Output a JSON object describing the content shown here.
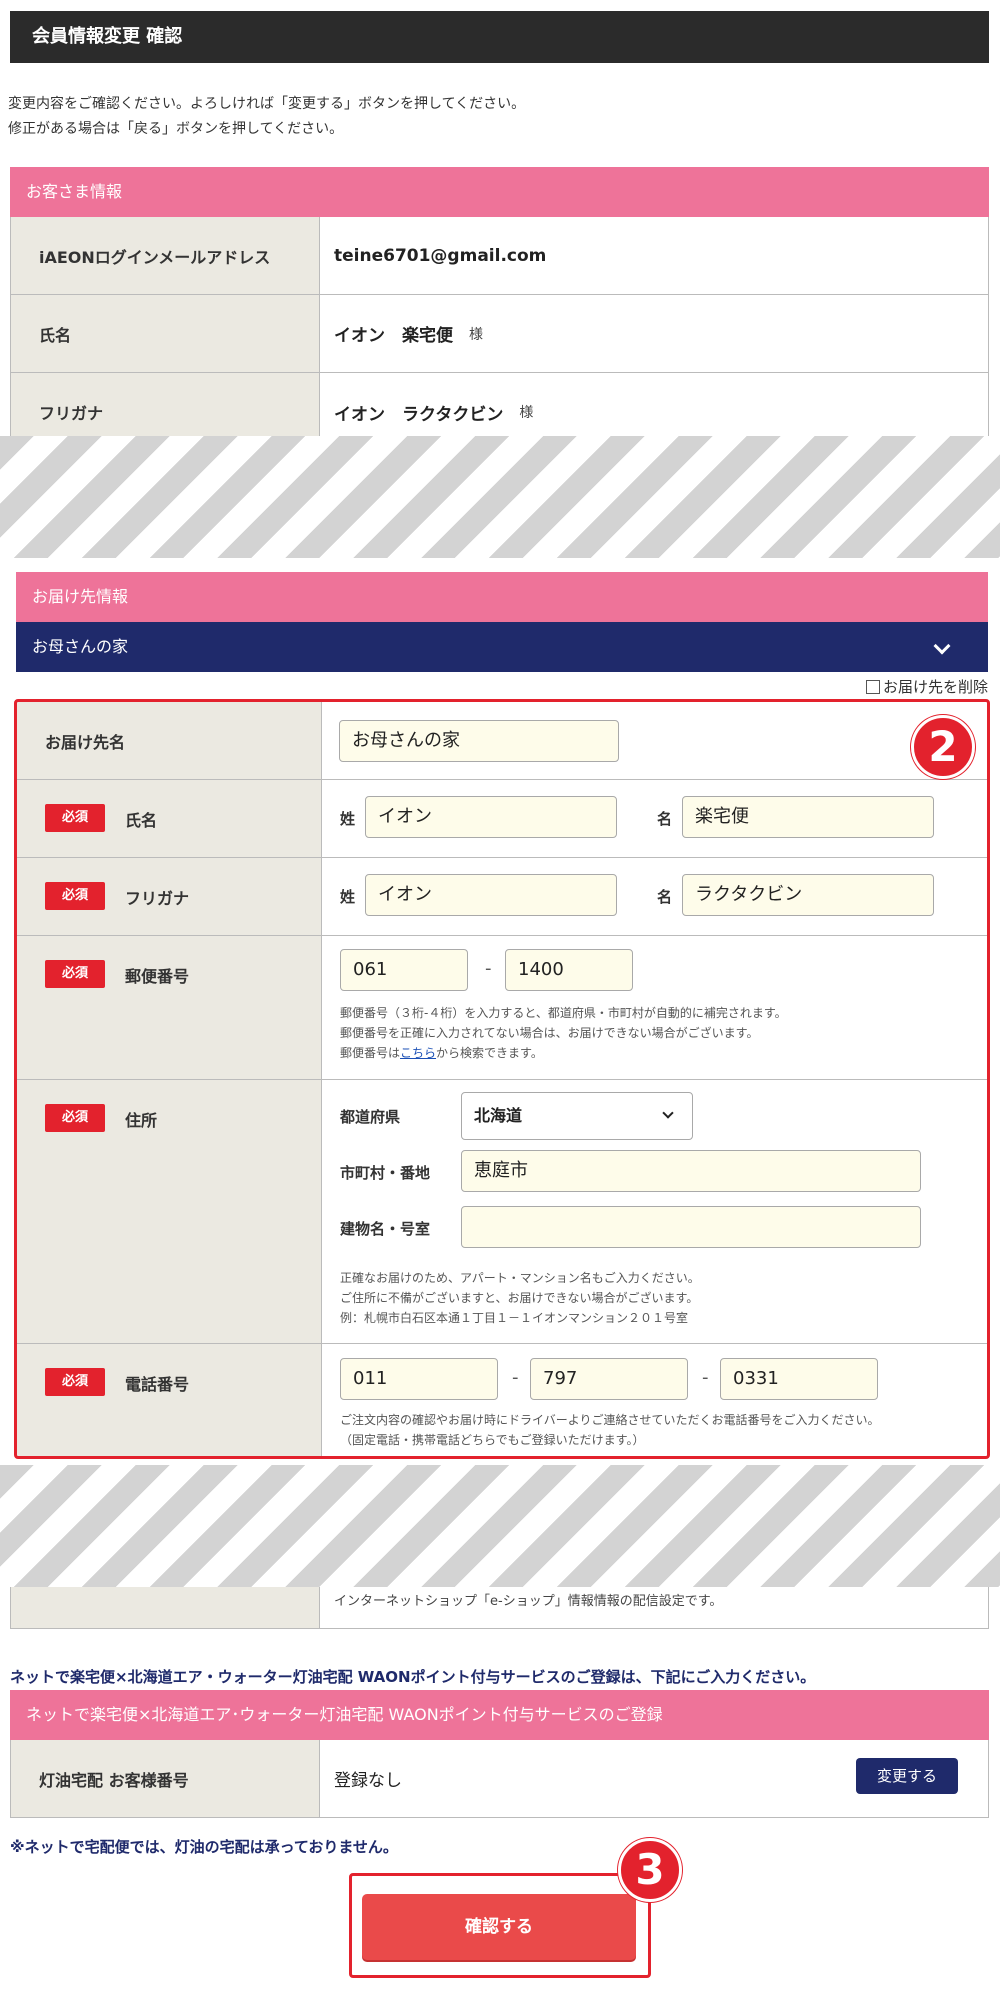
{
  "page_title": "会員情報変更 確認",
  "intro": {
    "line1": "変更内容をご確認ください。よろしければ「変更する」ボタンを押してください。",
    "line2": "修正がある場合は「戻る」ボタンを押してください。"
  },
  "customer": {
    "header": "お客さま情報",
    "rows": [
      {
        "label": "iAEONログインメールアドレス",
        "value": "teine6701@gmail.com",
        "suffix": ""
      },
      {
        "label": "氏名",
        "value": "イオン　楽宅便",
        "suffix": "様"
      },
      {
        "label": "フリガナ",
        "value": "イオン　ラクタクビン",
        "suffix": "様"
      }
    ]
  },
  "delivery": {
    "header": "お届け先情報",
    "selected_address": "お母さんの家",
    "delete_label": "お届け先を削除",
    "required_label": "必須",
    "name_label": "お届け先名",
    "name_value": "お母さんの家",
    "fullname": {
      "label": "氏名",
      "sei_label": "姓",
      "sei_value": "イオン",
      "mei_label": "名",
      "mei_value": "楽宅便"
    },
    "kana": {
      "label": "フリガナ",
      "sei_label": "姓",
      "sei_value": "イオン",
      "mei_label": "名",
      "mei_value": "ラクタクビン"
    },
    "postal": {
      "label": "郵便番号",
      "part1": "061",
      "separator": "-",
      "part2": "1400",
      "note1": "郵便番号（３桁-４桁）を入力すると、都道府県・市町村が自動的に補完されます。",
      "note2": "郵便番号を正確に入力されてない場合は、お届けできない場合がございます。",
      "note3_pre": "郵便番号は",
      "note3_link": "こちら",
      "note3_post": "から検索できます。"
    },
    "address": {
      "label": "住所",
      "pref_label": "都道府県",
      "pref_value": "北海道",
      "city_label": "市町村・番地",
      "city_value": "恵庭市",
      "building_label": "建物名・号室",
      "building_value": "",
      "note1": "正確なお届けのため、アパート・マンション名もご入力ください。",
      "note2": "ご住所に不備がございますと、お届けできない場合がございます。",
      "note3": "例：札幌市白石区本通１丁目１－１イオンマンション２０１号室"
    },
    "phone": {
      "label": "電話番号",
      "part1": "011",
      "part2": "797",
      "part3": "0331",
      "separator": "-",
      "note1": "ご注文内容の確認やお届け時にドライバーよりご連絡させていただくお電話番号をご入力ください。",
      "note2": "（固定電話・携帯電話どちらでもご登録いただけます。）"
    }
  },
  "newsletter_note": "インターネットショップ「e-ショップ」情報情報の配信設定です。",
  "kerosene": {
    "caption": "ネットで楽宅便×北海道エア・ウォーター灯油宅配 WAONポイント付与サービスのご登録は、下記にご入力ください。",
    "header": "ネットで楽宅便×北海道エア･ウォーター灯油宅配 WAONポイント付与サービスのご登録",
    "row_label": "灯油宅配 お客様番号",
    "row_value": "登録なし",
    "change_button": "変更する",
    "notice": "※ネットで宅配便では、灯油の宅配は承っておりません。"
  },
  "confirm_button": "確認する",
  "badges": {
    "two": "2",
    "three": "3"
  },
  "colors": {
    "accent_pink": "#ee7399",
    "navy": "#1f2a6b",
    "required_red": "#e3222d",
    "confirm_red": "#ea4a4a"
  }
}
